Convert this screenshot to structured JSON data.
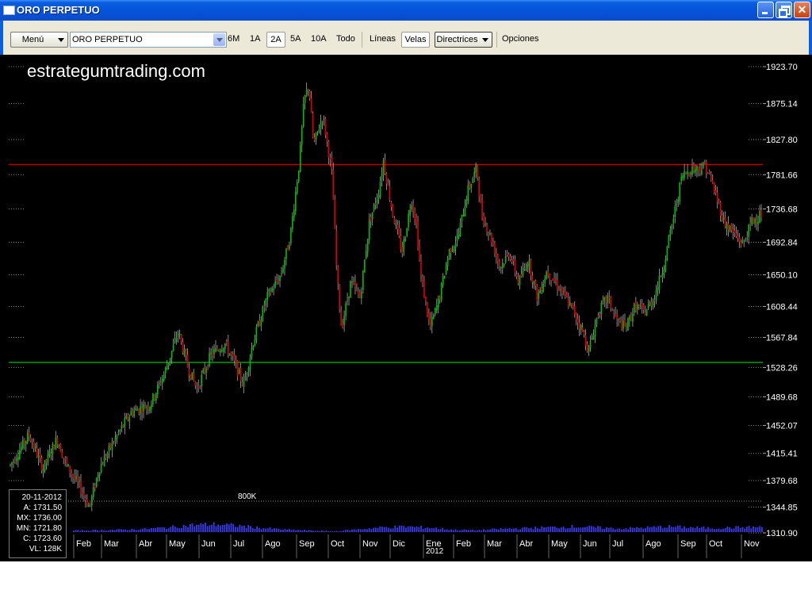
{
  "window": {
    "title": "ORO PERPETUO"
  },
  "toolbar": {
    "menu_label": "Menú",
    "symbol_value": "ORO PERPETUO",
    "ranges": [
      "6M",
      "1A",
      "2A",
      "5A",
      "10A",
      "Todo"
    ],
    "active_range": "2A",
    "lines_label": "Líneas",
    "candles_label": "Velas",
    "guides_label": "Directrices",
    "options_label": "Opciones"
  },
  "watermark": "estrategumtrading.com",
  "volume_label": "800K",
  "info": {
    "date": "20-11-2012",
    "open": "A: 1731.50",
    "high": "MX: 1736.00",
    "low": "MN: 1721.80",
    "close": "C: 1723.60",
    "volume": "VL: 128K"
  },
  "colors": {
    "up": "#00c000",
    "down": "#e00000",
    "resistance": "#c00000",
    "support": "#00a000",
    "volume": "#3a3ae8"
  },
  "chart_data": {
    "type": "candlestick",
    "y_ticks": [
      "1923.70",
      "1875.14",
      "1827.80",
      "1781.66",
      "1736.68",
      "1692.84",
      "1650.10",
      "1608.44",
      "1567.84",
      "1528.26",
      "1489.68",
      "1452.07",
      "1415.41",
      "1379.68",
      "1344.85",
      "1310.90"
    ],
    "ylim": [
      1310.9,
      1923.7
    ],
    "x_ticks": [
      "Feb",
      "Mar",
      "Abr",
      "May",
      "Jun",
      "Jul",
      "Ago",
      "Sep",
      "Oct",
      "Nov",
      "Dic",
      "Ene",
      "Feb",
      "Mar",
      "Abr",
      "May",
      "Jun",
      "Jul",
      "Ago",
      "Sep",
      "Oct",
      "Nov"
    ],
    "year_label": "2012",
    "resistance_level": 1795,
    "support_level": 1535,
    "price_path": [
      [
        0,
        1400
      ],
      [
        4,
        1440
      ],
      [
        7,
        1395
      ],
      [
        10,
        1435
      ],
      [
        12,
        1400
      ],
      [
        15,
        1370
      ],
      [
        17,
        1345
      ],
      [
        19,
        1395
      ],
      [
        23,
        1440
      ],
      [
        26,
        1470
      ],
      [
        30,
        1480
      ],
      [
        33,
        1520
      ],
      [
        36,
        1575
      ],
      [
        38,
        1530
      ],
      [
        40,
        1500
      ],
      [
        43,
        1545
      ],
      [
        46,
        1560
      ],
      [
        48,
        1535
      ],
      [
        50,
        1505
      ],
      [
        52,
        1560
      ],
      [
        55,
        1620
      ],
      [
        58,
        1650
      ],
      [
        60,
        1700
      ],
      [
        62,
        1800
      ],
      [
        63,
        1880
      ],
      [
        64,
        1900
      ],
      [
        65,
        1820
      ],
      [
        67,
        1860
      ],
      [
        69,
        1780
      ],
      [
        70,
        1650
      ],
      [
        71,
        1580
      ],
      [
        73,
        1640
      ],
      [
        75,
        1620
      ],
      [
        77,
        1720
      ],
      [
        79,
        1760
      ],
      [
        80,
        1800
      ],
      [
        82,
        1730
      ],
      [
        84,
        1680
      ],
      [
        86,
        1750
      ],
      [
        87,
        1720
      ],
      [
        88,
        1650
      ],
      [
        90,
        1580
      ],
      [
        92,
        1620
      ],
      [
        94,
        1680
      ],
      [
        96,
        1700
      ],
      [
        98,
        1760
      ],
      [
        100,
        1790
      ],
      [
        101,
        1730
      ],
      [
        103,
        1700
      ],
      [
        105,
        1660
      ],
      [
        107,
        1680
      ],
      [
        109,
        1640
      ],
      [
        111,
        1670
      ],
      [
        113,
        1620
      ],
      [
        115,
        1655
      ],
      [
        117,
        1640
      ],
      [
        119,
        1620
      ],
      [
        121,
        1600
      ],
      [
        123,
        1570
      ],
      [
        124,
        1550
      ],
      [
        126,
        1600
      ],
      [
        128,
        1620
      ],
      [
        130,
        1590
      ],
      [
        132,
        1580
      ],
      [
        134,
        1610
      ],
      [
        136,
        1600
      ],
      [
        138,
        1620
      ],
      [
        140,
        1660
      ],
      [
        142,
        1720
      ],
      [
        144,
        1780
      ],
      [
        146,
        1790
      ],
      [
        148,
        1790
      ],
      [
        149,
        1795
      ],
      [
        151,
        1760
      ],
      [
        153,
        1720
      ],
      [
        155,
        1705
      ],
      [
        157,
        1690
      ],
      [
        159,
        1720
      ],
      [
        161,
        1730
      ]
    ],
    "volume_levels": [
      0.1,
      0.12,
      0.15,
      0.2,
      0.3,
      0.45,
      0.5,
      0.4,
      0.25,
      0.15,
      0.1,
      0.05,
      0.18,
      0.3,
      0.35,
      0.28,
      0.15,
      0.12,
      0.2,
      0.25,
      0.3,
      0.35,
      0.3,
      0.22,
      0.28,
      0.35,
      0.3,
      0.25,
      0.3,
      0.32
    ]
  }
}
